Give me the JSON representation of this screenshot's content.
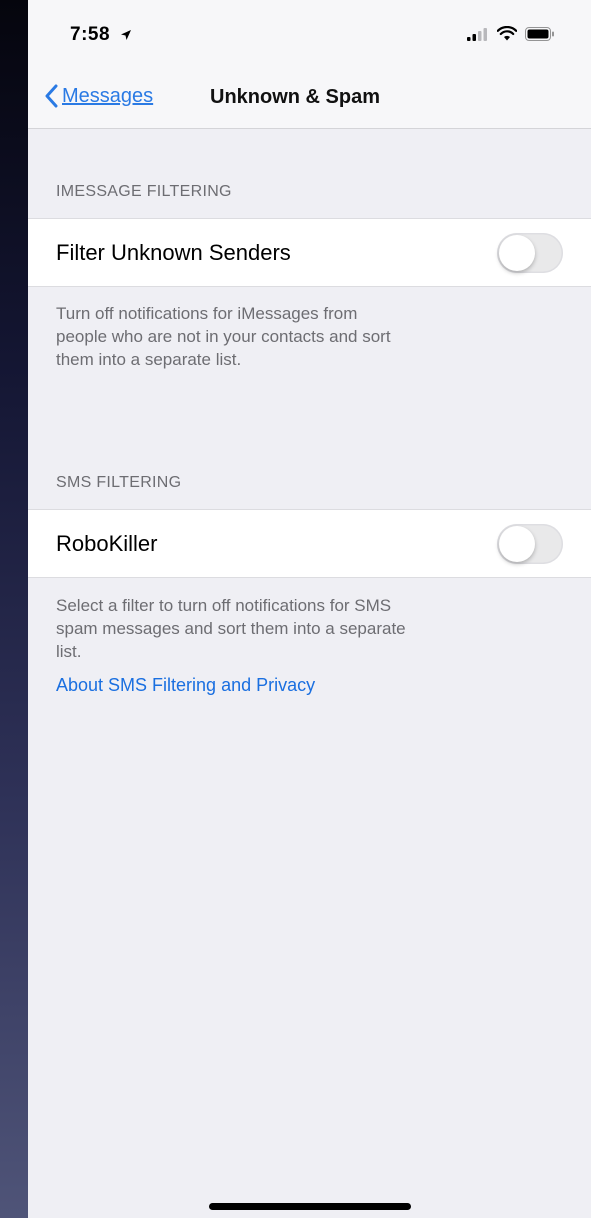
{
  "status_bar": {
    "time": "7:58",
    "icons": [
      "location-arrow-icon",
      "signal-icon",
      "wifi-icon",
      "battery-icon"
    ]
  },
  "nav": {
    "back_label": "Messages",
    "title": "Unknown & Spam"
  },
  "sections": {
    "imessage": {
      "header": "IMESSAGE FILTERING",
      "row_label": "Filter Unknown Senders",
      "toggle_on": false,
      "footer_lines": [
        "Turn off notifications for iMessages from",
        "people who are not in your contacts and sort",
        "them into a separate list."
      ]
    },
    "sms": {
      "header": "SMS FILTERING",
      "row_label": "RoboKiller",
      "toggle_on": false,
      "footer_lines": [
        "Select a filter to turn off notifications for SMS",
        "spam messages and sort them into a separate",
        "list."
      ],
      "link": "About SMS Filtering and Privacy"
    }
  },
  "colors": {
    "link_blue": "#1a6fe0",
    "background": "#efeff4",
    "secondary_text": "#6d6d72"
  }
}
